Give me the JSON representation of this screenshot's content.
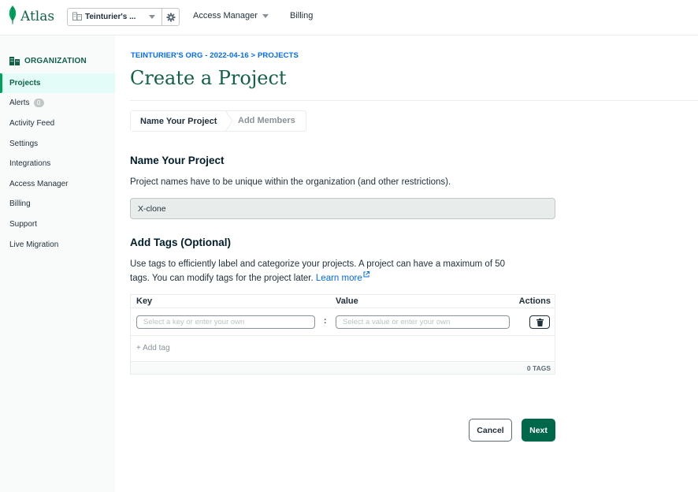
{
  "header": {
    "logo_text": "Atlas",
    "org_name": "Teinturier's ...",
    "nav_access_manager": "Access Manager",
    "nav_billing": "Billing"
  },
  "sidebar": {
    "section_title": "ORGANIZATION",
    "items": [
      {
        "label": "Projects",
        "active": true
      },
      {
        "label": "Alerts",
        "badge": "0"
      },
      {
        "label": "Activity Feed"
      },
      {
        "label": "Settings"
      },
      {
        "label": "Integrations"
      },
      {
        "label": "Access Manager"
      },
      {
        "label": "Billing"
      },
      {
        "label": "Support"
      },
      {
        "label": "Live Migration"
      }
    ]
  },
  "main": {
    "breadcrumb": "TEINTURIER'S ORG - 2022-04-16 > PROJECTS",
    "title": "Create a Project",
    "steps": [
      "Name Your Project",
      "Add Members"
    ],
    "name_section": {
      "heading": "Name Your Project",
      "description": "Project names have to be unique within the organization (and other restrictions).",
      "value": "X-clone"
    },
    "tags_section": {
      "heading": "Add Tags (Optional)",
      "description_line1": "Use tags to efficiently label and categorize your projects. A project can have a maximum of 50",
      "description_line2": "tags. You can modify tags for the project later.",
      "learn_more": "Learn more",
      "columns": {
        "key": "Key",
        "value": "Value",
        "actions": "Actions"
      },
      "key_placeholder": "Select a key or enter your own",
      "value_placeholder": "Select a value or enter your own",
      "separator": ":",
      "add_tag": "+ Add tag",
      "count": "0 TAGS"
    },
    "buttons": {
      "cancel": "Cancel",
      "next": "Next"
    }
  },
  "colors": {
    "brand_green": "#116149",
    "button_green": "#00684a",
    "link_blue": "#016bf8",
    "active_bg": "#e3fcf7"
  }
}
